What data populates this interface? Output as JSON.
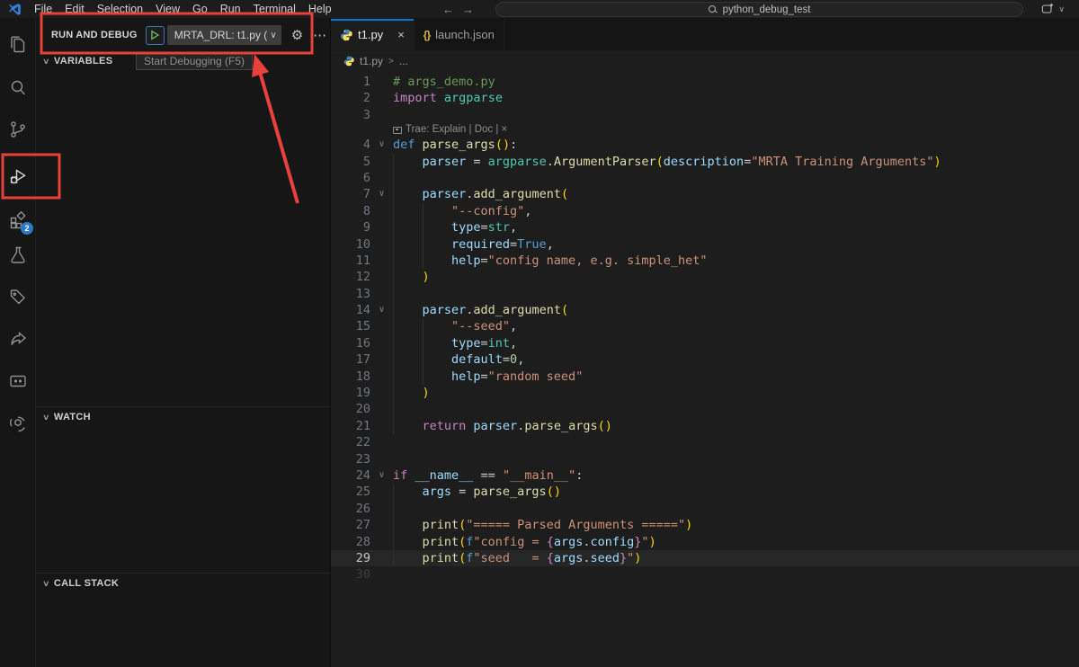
{
  "title_bar": {
    "menus": [
      "File",
      "Edit",
      "Selection",
      "View",
      "Go",
      "Run",
      "Terminal",
      "Help"
    ],
    "search_value": "python_debug_test"
  },
  "activity_bar": {
    "items": [
      "explorer",
      "search",
      "source-control",
      "run-and-debug",
      "extensions",
      "testing",
      "tags",
      "share",
      "chat",
      "ai-assistant"
    ],
    "active_item": "run-and-debug",
    "extensions_badge": "2"
  },
  "sidebar": {
    "header": {
      "title": "RUN AND DEBUG",
      "config_label": "MRTA_DRL: t1.py (",
      "tooltip": "Start Debugging (F5)"
    },
    "sections": [
      "VARIABLES",
      "WATCH",
      "CALL STACK"
    ]
  },
  "editor": {
    "tabs": [
      {
        "label": "t1.py",
        "active": true,
        "icon": "python"
      },
      {
        "label": "launch.json",
        "active": false,
        "icon": "json"
      }
    ],
    "breadcrumb": {
      "file": "t1.py",
      "sep": ">",
      "more": "..."
    },
    "lines": [
      {
        "n": 1,
        "t": [
          [
            "c",
            "# args_demo.py"
          ]
        ]
      },
      {
        "n": 2,
        "t": [
          [
            "k",
            "import"
          ],
          [
            "p",
            " "
          ],
          [
            "t",
            "argparse"
          ]
        ]
      },
      {
        "n": 3,
        "t": []
      },
      {
        "lens": "Trae: Explain | Doc | ×"
      },
      {
        "n": 4,
        "fold": 1,
        "t": [
          [
            "d",
            "def"
          ],
          [
            "p",
            " "
          ],
          [
            "f",
            "parse_args"
          ],
          [
            "g",
            "()"
          ],
          [
            "p",
            ":"
          ]
        ]
      },
      {
        "n": 5,
        "t": [
          [
            "i"
          ],
          [
            "v",
            "parser"
          ],
          [
            "p",
            " = "
          ],
          [
            "t",
            "argparse"
          ],
          [
            "p",
            "."
          ],
          [
            "f",
            "ArgumentParser"
          ],
          [
            "g",
            "("
          ],
          [
            "v",
            "description"
          ],
          [
            "p",
            "="
          ],
          [
            "s",
            "\"MRTA Training Arguments\""
          ],
          [
            "g",
            ")"
          ]
        ]
      },
      {
        "n": 6,
        "t": [
          [
            "i"
          ]
        ]
      },
      {
        "n": 7,
        "fold": 1,
        "t": [
          [
            "i"
          ],
          [
            "v",
            "parser"
          ],
          [
            "p",
            "."
          ],
          [
            "f",
            "add_argument"
          ],
          [
            "g",
            "("
          ]
        ]
      },
      {
        "n": 8,
        "t": [
          [
            "i"
          ],
          [
            "i"
          ],
          [
            "s",
            "\"--config\""
          ],
          [
            "p",
            ","
          ]
        ]
      },
      {
        "n": 9,
        "t": [
          [
            "i"
          ],
          [
            "i"
          ],
          [
            "v",
            "type"
          ],
          [
            "p",
            "="
          ],
          [
            "t",
            "str"
          ],
          [
            "p",
            ","
          ]
        ]
      },
      {
        "n": 10,
        "t": [
          [
            "i"
          ],
          [
            "i"
          ],
          [
            "v",
            "required"
          ],
          [
            "p",
            "="
          ],
          [
            "d",
            "True"
          ],
          [
            "p",
            ","
          ]
        ]
      },
      {
        "n": 11,
        "t": [
          [
            "i"
          ],
          [
            "i"
          ],
          [
            "v",
            "help"
          ],
          [
            "p",
            "="
          ],
          [
            "s",
            "\"config name, e.g. simple_het\""
          ]
        ]
      },
      {
        "n": 12,
        "t": [
          [
            "i"
          ],
          [
            "g",
            ")"
          ]
        ]
      },
      {
        "n": 13,
        "t": [
          [
            "i"
          ]
        ]
      },
      {
        "n": 14,
        "fold": 1,
        "t": [
          [
            "i"
          ],
          [
            "v",
            "parser"
          ],
          [
            "p",
            "."
          ],
          [
            "f",
            "add_argument"
          ],
          [
            "g",
            "("
          ]
        ]
      },
      {
        "n": 15,
        "t": [
          [
            "i"
          ],
          [
            "i"
          ],
          [
            "s",
            "\"--seed\""
          ],
          [
            "p",
            ","
          ]
        ]
      },
      {
        "n": 16,
        "t": [
          [
            "i"
          ],
          [
            "i"
          ],
          [
            "v",
            "type"
          ],
          [
            "p",
            "="
          ],
          [
            "t",
            "int"
          ],
          [
            "p",
            ","
          ]
        ]
      },
      {
        "n": 17,
        "t": [
          [
            "i"
          ],
          [
            "i"
          ],
          [
            "v",
            "default"
          ],
          [
            "p",
            "="
          ],
          [
            "n",
            "0"
          ],
          [
            "p",
            ","
          ]
        ]
      },
      {
        "n": 18,
        "t": [
          [
            "i"
          ],
          [
            "i"
          ],
          [
            "v",
            "help"
          ],
          [
            "p",
            "="
          ],
          [
            "s",
            "\"random seed\""
          ]
        ]
      },
      {
        "n": 19,
        "t": [
          [
            "i"
          ],
          [
            "g",
            ")"
          ]
        ]
      },
      {
        "n": 20,
        "t": [
          [
            "i"
          ]
        ]
      },
      {
        "n": 21,
        "t": [
          [
            "i"
          ],
          [
            "k",
            "return"
          ],
          [
            "p",
            " "
          ],
          [
            "v",
            "parser"
          ],
          [
            "p",
            "."
          ],
          [
            "f",
            "parse_args"
          ],
          [
            "g",
            "()"
          ]
        ]
      },
      {
        "n": 22,
        "t": []
      },
      {
        "n": 23,
        "t": []
      },
      {
        "n": 24,
        "fold": 1,
        "t": [
          [
            "k",
            "if"
          ],
          [
            "p",
            " "
          ],
          [
            "v",
            "__name__"
          ],
          [
            "p",
            " == "
          ],
          [
            "s",
            "\"__main__\""
          ],
          [
            "p",
            ":"
          ]
        ]
      },
      {
        "n": 25,
        "t": [
          [
            "i"
          ],
          [
            "v",
            "args"
          ],
          [
            "p",
            " = "
          ],
          [
            "f",
            "parse_args"
          ],
          [
            "g",
            "()"
          ]
        ]
      },
      {
        "n": 26,
        "t": [
          [
            "i"
          ]
        ]
      },
      {
        "n": 27,
        "t": [
          [
            "i"
          ],
          [
            "f",
            "print"
          ],
          [
            "g",
            "("
          ],
          [
            "s",
            "\"===== Parsed Arguments =====\""
          ],
          [
            "g",
            ")"
          ]
        ]
      },
      {
        "n": 28,
        "t": [
          [
            "i"
          ],
          [
            "f",
            "print"
          ],
          [
            "g",
            "("
          ],
          [
            "d",
            "f"
          ],
          [
            "s",
            "\"config = "
          ],
          [
            "b",
            "{"
          ],
          [
            "v",
            "args"
          ],
          [
            "p",
            "."
          ],
          [
            "v",
            "config"
          ],
          [
            "b",
            "}"
          ],
          [
            "s",
            "\""
          ],
          [
            "g",
            ")"
          ]
        ]
      },
      {
        "n": 29,
        "cur": 1,
        "t": [
          [
            "i"
          ],
          [
            "f",
            "print"
          ],
          [
            "g",
            "("
          ],
          [
            "d",
            "f"
          ],
          [
            "s",
            "\"seed   = "
          ],
          [
            "b",
            "{"
          ],
          [
            "v",
            "args"
          ],
          [
            "p",
            "."
          ],
          [
            "v",
            "seed"
          ],
          [
            "b",
            "}"
          ],
          [
            "s",
            "\""
          ],
          [
            "g",
            ")"
          ]
        ]
      },
      {
        "n": 30,
        "dim": 1,
        "t": []
      }
    ]
  },
  "icons": {
    "close": "×",
    "chevron_down": "∨",
    "gear": "⚙",
    "dots": "⋯",
    "arrow_left": "←",
    "arrow_right": "→",
    "braces": "{}"
  },
  "annotations": {
    "color": "#e8413c"
  }
}
